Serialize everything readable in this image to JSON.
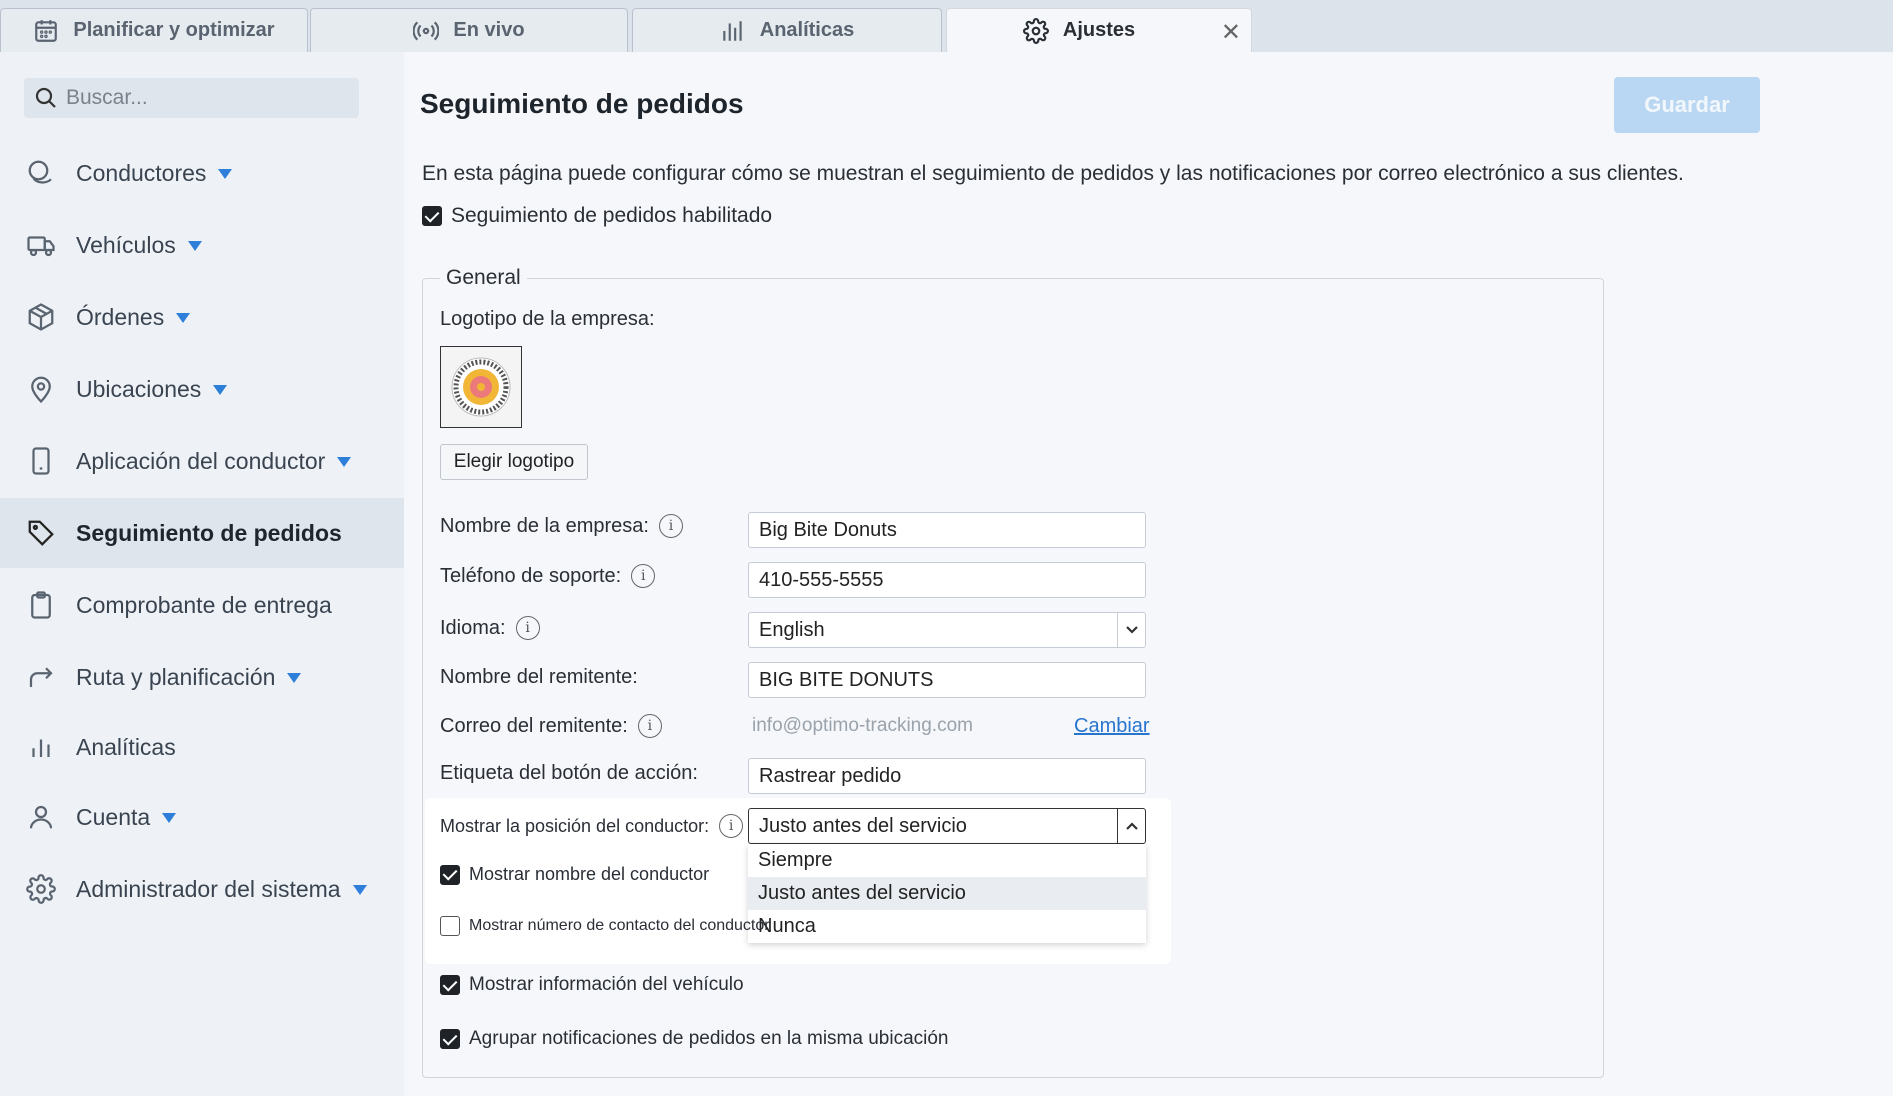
{
  "tabs": [
    {
      "label": "Planificar y optimizar",
      "icon": "calendar-icon"
    },
    {
      "label": "En vivo",
      "icon": "broadcast-icon"
    },
    {
      "label": "Analíticas",
      "icon": "bar-chart-icon"
    },
    {
      "label": "Ajustes",
      "icon": "gear-icon",
      "active": true
    }
  ],
  "sidebar": {
    "search_placeholder": "Buscar...",
    "items": [
      {
        "label": "Conductores",
        "icon": "drivers-icon",
        "caret": true
      },
      {
        "label": "Vehículos",
        "icon": "truck-icon",
        "caret": true
      },
      {
        "label": "Órdenes",
        "icon": "box-icon",
        "caret": true
      },
      {
        "label": "Ubicaciones",
        "icon": "location-pin-icon",
        "caret": true
      },
      {
        "label": "Aplicación del conductor",
        "icon": "phone-icon",
        "caret": true
      },
      {
        "label": "Seguimiento de pedidos",
        "icon": "tag-icon",
        "active": true
      },
      {
        "label": "Comprobante de entrega",
        "icon": "clipboard-icon"
      },
      {
        "label": "Ruta y planificación",
        "icon": "route-arrow-icon",
        "caret": true
      },
      {
        "label": "Analíticas",
        "icon": "analytics-icon"
      },
      {
        "label": "Cuenta",
        "icon": "user-icon",
        "caret": true
      },
      {
        "label": "Administrador del sistema",
        "icon": "gear-icon",
        "caret": true
      }
    ]
  },
  "main": {
    "title": "Seguimiento de pedidos",
    "save_label": "Guardar",
    "description": "En esta página puede configurar cómo se muestran el seguimiento de pedidos y las notificaciones por correo electrónico a sus clientes.",
    "tracking_enabled_label": "Seguimiento de pedidos habilitado",
    "general_legend": "General",
    "logo_label": "Logotipo de la empresa:",
    "choose_logo_label": "Elegir logotipo",
    "company_name_label": "Nombre de la empresa:",
    "company_name_value": "Big Bite Donuts",
    "support_phone_label": "Teléfono de soporte:",
    "support_phone_value": "410-555-5555",
    "language_label": "Idioma:",
    "language_value": "English",
    "sender_name_label": "Nombre del remitente:",
    "sender_name_value": "BIG BITE DONUTS",
    "sender_email_label": "Correo del remitente:",
    "sender_email_value": "info@optimo-tracking.com",
    "change_label": "Cambiar",
    "action_button_label": "Etiqueta del botón de acción:",
    "action_button_value": "Rastrear pedido",
    "driver_position_label": "Mostrar la posición del conductor:",
    "driver_position_value": "Justo antes del servicio",
    "driver_position_options": [
      "Siempre",
      "Justo antes del servicio",
      "Nunca"
    ],
    "show_driver_name_label": "Mostrar nombre del conductor",
    "show_driver_contact_label": "Mostrar número de contacto del conductor",
    "show_vehicle_info_label": "Mostrar información del vehículo",
    "group_notifications_label": "Agrupar notificaciones de pedidos en la misma ubicación"
  }
}
